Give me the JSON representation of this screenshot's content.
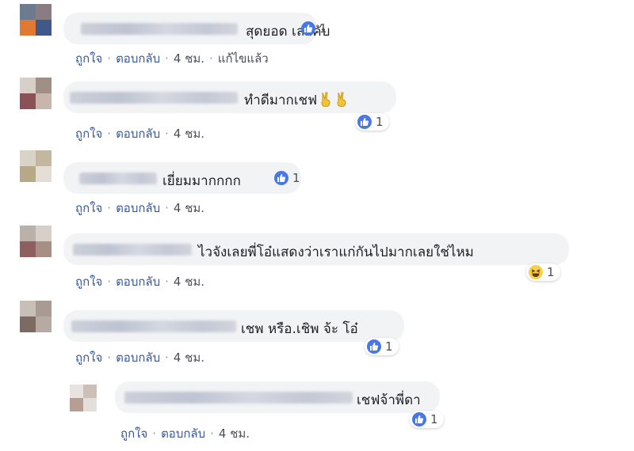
{
  "comments": [
    {
      "text": "สุดยอด เลยคับ",
      "reaction": {
        "type": "like",
        "count": "1"
      },
      "actions": {
        "like": "ถูกใจ",
        "reply": "ตอบกลับ",
        "time": "4 ชม.",
        "edited": "แก้ไขแล้ว"
      }
    },
    {
      "text": "ทำดีมากเชฟ",
      "reaction": {
        "type": "like",
        "count": "1"
      },
      "actions": {
        "like": "ถูกใจ",
        "reply": "ตอบกลับ",
        "time": "4 ชม."
      }
    },
    {
      "text": "เยี่ยมมากกกก",
      "reaction": {
        "type": "like",
        "count": "1"
      },
      "actions": {
        "like": "ถูกใจ",
        "reply": "ตอบกลับ",
        "time": "4 ชม."
      }
    },
    {
      "text": "ไวจังเลยพี่โอ๋แสดงว่าเราแก่กันไปมากเลยใช่ไหม",
      "reaction": {
        "type": "haha",
        "count": "1"
      },
      "actions": {
        "like": "ถูกใจ",
        "reply": "ตอบกลับ",
        "time": "4 ชม."
      }
    },
    {
      "text": "เชพ หรือ.เชิพ จ้ะ โอ๋",
      "reaction": {
        "type": "like",
        "count": "1"
      },
      "actions": {
        "like": "ถูกใจ",
        "reply": "ตอบกลับ",
        "time": "4 ชม."
      }
    },
    {
      "text": "เชฟจ้าพี่ดา",
      "reaction": {
        "type": "like",
        "count": "1"
      },
      "actions": {
        "like": "ถูกใจ",
        "reply": "ตอบกลับ",
        "time": "4 ชม."
      }
    }
  ],
  "colors": {
    "bubble": "#f2f3f5",
    "link": "#385898",
    "meta": "#4b4f56",
    "like": "#4a77e8"
  },
  "icons": {
    "like": "thumbs-up-icon",
    "haha": "laughing-face-icon",
    "victory": "victory-hand-icon"
  }
}
